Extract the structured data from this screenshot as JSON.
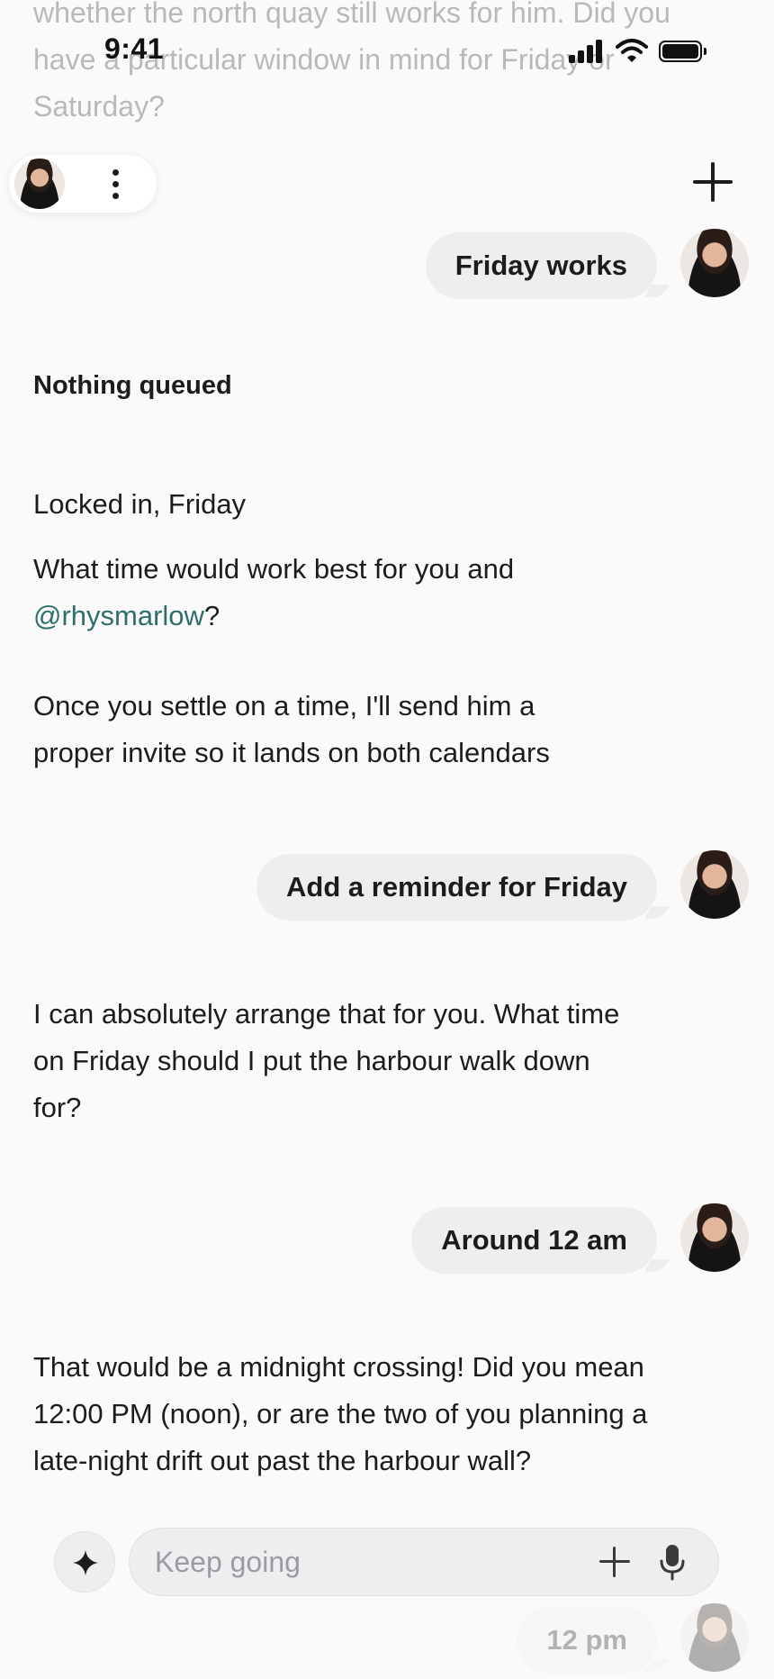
{
  "status_bar": {
    "time": "9:41"
  },
  "faded_top_text": "whether the north quay still works for him. Did you have a particular window in mind for Friday or Saturday?",
  "header": {
    "more_icon": "kebab-vertical-icon",
    "new_chat_icon": "plus-icon"
  },
  "messages": {
    "user_1": "Friday works",
    "section_heading": "Nothing queued",
    "assistant_1": {
      "line_1": "Locked in, Friday",
      "line_2_prefix": "What time would work best for you and ",
      "mention": "@rhysmarlow",
      "line_2_suffix": "?",
      "line_3": "Once you settle on a time, I'll send him a proper invite so it lands on both calendars"
    },
    "user_2": "Add a reminder for Friday",
    "assistant_2": "I can absolutely arrange that for you. What time on Friday should I put the harbour walk down for?",
    "user_3": "Around 12 am",
    "assistant_3": "That would be a midnight crossing! Did you mean 12:00 PM (noon), or are the two of you planning a late-night drift out past the harbour wall?",
    "user_4": "12 pm"
  },
  "composer": {
    "placeholder": "Keep going",
    "value": "",
    "icons": [
      "sparkle-icon",
      "plus-icon",
      "microphone-icon"
    ]
  },
  "colors": {
    "background": "#fafafa",
    "bubble": "#eeeef0",
    "mention": "#2f6f6b"
  }
}
